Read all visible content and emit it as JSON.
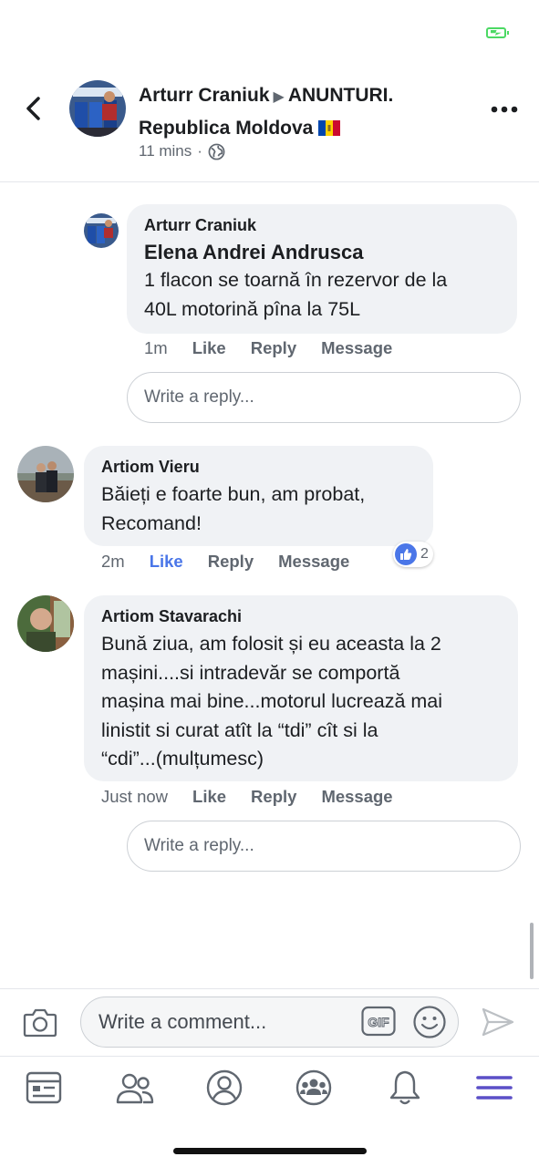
{
  "header": {
    "author": "Arturr Craniuk",
    "group": "ANUNTURI.",
    "group_line2": "Republica Moldova",
    "timestamp": "11 mins",
    "separator": "·"
  },
  "comments": [
    {
      "author": "Arturr Craniuk",
      "mention": "Elena Andrei Andrusca",
      "text_lines": [
        "1 flacon se toarnă în rezervor de la",
        "40L motorină pîna la 75L"
      ],
      "time": "1m",
      "like": "Like",
      "reply": "Reply",
      "message": "Message",
      "reply_placeholder": "Write a reply..."
    },
    {
      "author": "Artiom Vieru",
      "text_lines": [
        "Băieți e foarte bun, am probat,",
        "Recomand!"
      ],
      "time": "2m",
      "like": "Like",
      "reply": "Reply",
      "message": "Message",
      "reaction_count": "2"
    },
    {
      "author": "Artiom Stavarachi",
      "text_lines": [
        "Bună ziua, am folosit și eu aceasta la 2",
        "mașini....si intradevăr se comportă",
        "mașina mai bine...motorul lucrează mai",
        "linistit si curat atît la “tdi” cît si la",
        "“cdi”...(mulțumesc)"
      ],
      "time": "Just now",
      "like": "Like",
      "reply": "Reply",
      "message": "Message",
      "reply_placeholder": "Write a reply..."
    }
  ],
  "composer": {
    "placeholder": "Write a comment...",
    "gif_label": "GIF"
  },
  "tabs": [
    "news-feed",
    "friends",
    "profile",
    "groups",
    "notifications",
    "menu"
  ],
  "colors": {
    "accent": "#4a76e8",
    "bubble": "#f0f2f5",
    "secondary_text": "#606770",
    "active_tab": "#5b4fc7",
    "battery": "#4cd964"
  }
}
